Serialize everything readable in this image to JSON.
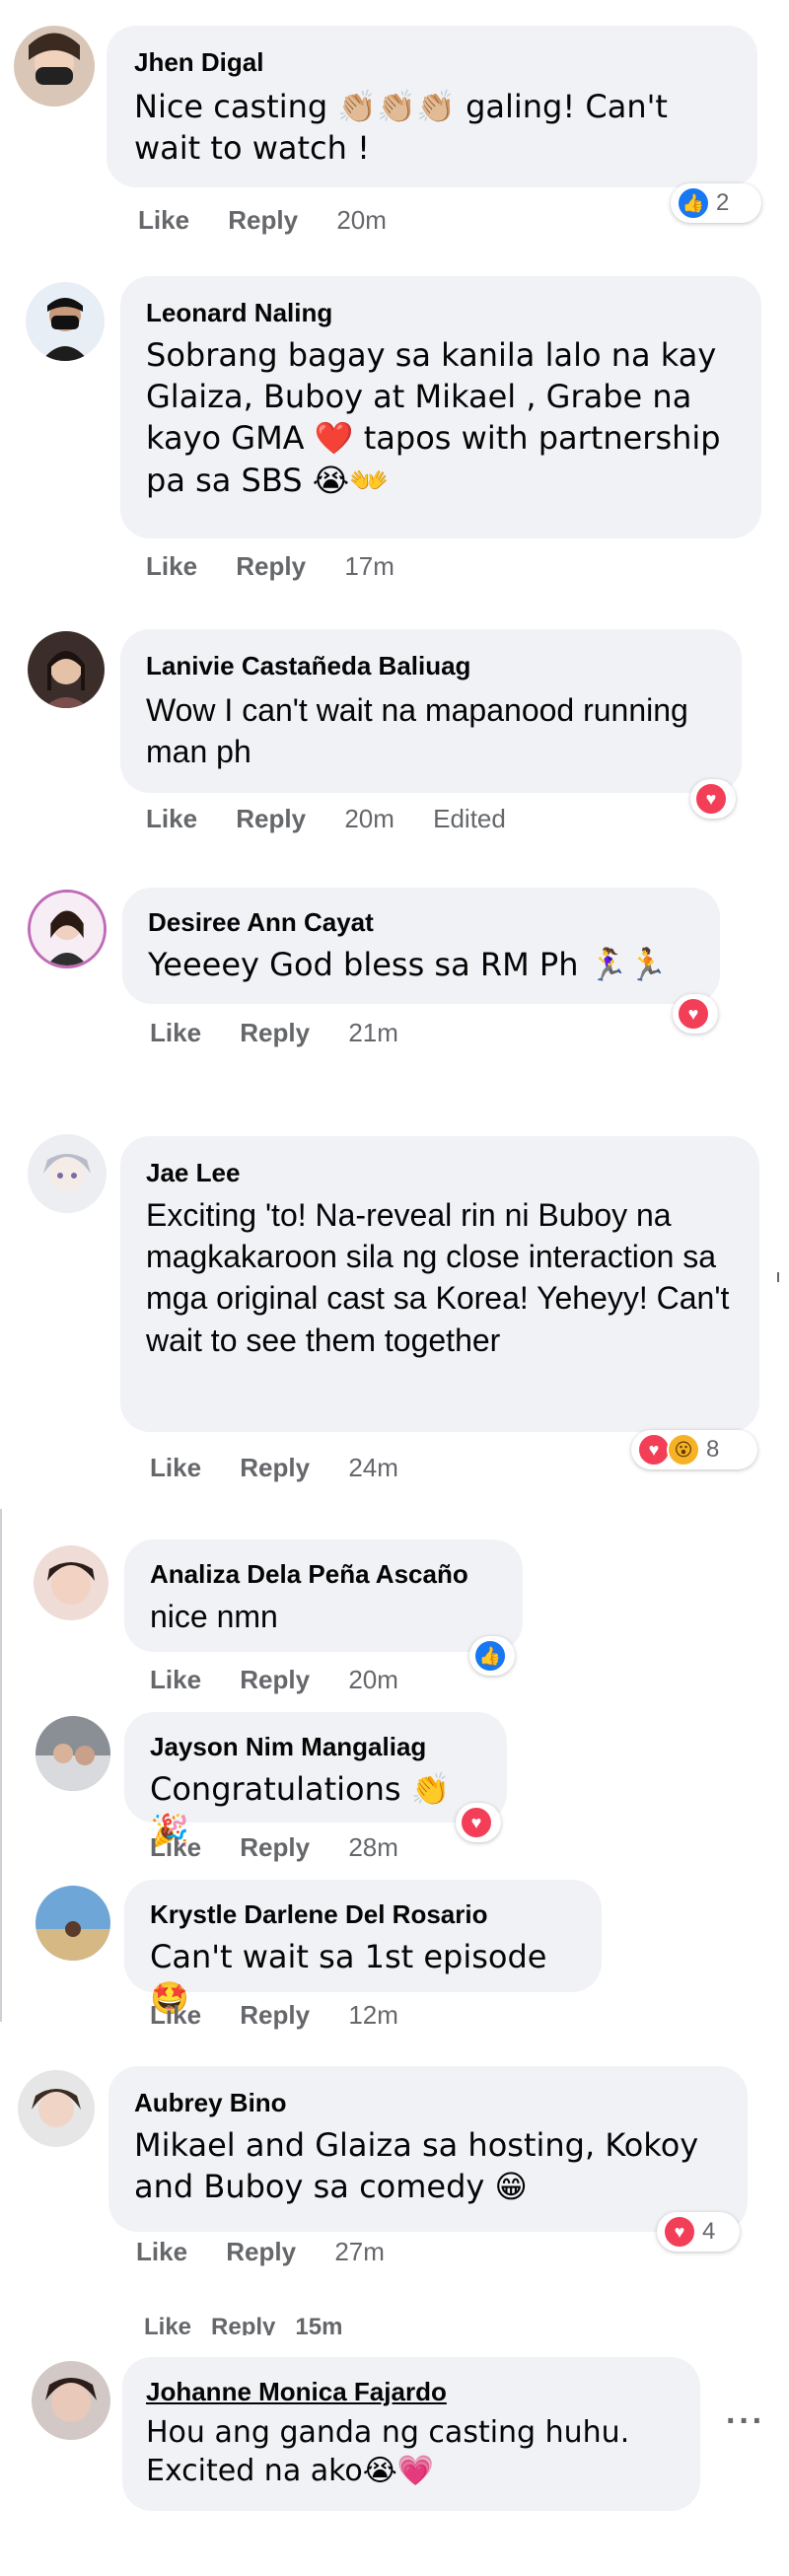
{
  "comments": [
    {
      "name": "Jhen Digal",
      "text": "Nice casting 👏🏼👏🏼👏🏼 galing! Can't wait to watch !",
      "like": "Like",
      "reply": "Reply",
      "time": "20m",
      "reaction_count": "2"
    },
    {
      "name": "Leonard Naling",
      "text": "Sobrang bagay sa kanila lalo na kay Glaiza, Buboy at Mikael , Grabe na kayo GMA ❤️ tapos with partnership pa sa SBS 😭👐",
      "like": "Like",
      "reply": "Reply",
      "time": "17m"
    },
    {
      "name": "Lanivie Castañeda Baliuag",
      "text": "Wow I can't wait na mapanood running man ph",
      "like": "Like",
      "reply": "Reply",
      "time": "20m",
      "edited": "Edited"
    },
    {
      "name": "Desiree Ann Cayat",
      "text": "Yeeeey God bless sa RM Ph 🏃‍♀️🏃",
      "like": "Like",
      "reply": "Reply",
      "time": "21m"
    },
    {
      "name": "Jae Lee",
      "text": "Exciting 'to! Na-reveal rin ni Buboy na magkakaroon sila ng close interaction sa mga original cast sa Korea! Yeheyy! Can't wait to see them together",
      "like": "Like",
      "reply": "Reply",
      "time": "24m",
      "reaction_count": "8"
    },
    {
      "name": "Analiza Dela Peña Ascaño",
      "text": "nice nmn",
      "like": "Like",
      "reply": "Reply",
      "time": "20m"
    },
    {
      "name": "Jayson Nim Mangaliag",
      "text": "Congratulations 👏🎉",
      "like": "Like",
      "reply": "Reply",
      "time": "28m"
    },
    {
      "name": "Krystle Darlene Del Rosario",
      "text": "Can't wait sa 1st episode 🤩",
      "like": "Like",
      "reply": "Reply",
      "time": "12m"
    },
    {
      "name": "Aubrey Bino",
      "text": "Mikael and Glaiza sa hosting, Kokoy and Buboy sa comedy 😁",
      "like": "Like",
      "reply": "Reply",
      "time": "27m",
      "reaction_count": "4"
    },
    {
      "clipped_actions": "Like   Reply   15m"
    },
    {
      "name": "Johanne Monica Fajardo",
      "text": "Hou ang ganda ng casting huhu. Excited na ako😭💗",
      "more": "···"
    }
  ],
  "icons": {
    "like": "like-reaction-icon",
    "love": "love-reaction-icon",
    "wow": "wow-reaction-icon",
    "more": "more-options-icon"
  },
  "colors": {
    "bubble": "#f0f2f5",
    "secondary_text": "#65676b",
    "like_blue": "#1877f2",
    "love_red": "#f33e58"
  }
}
